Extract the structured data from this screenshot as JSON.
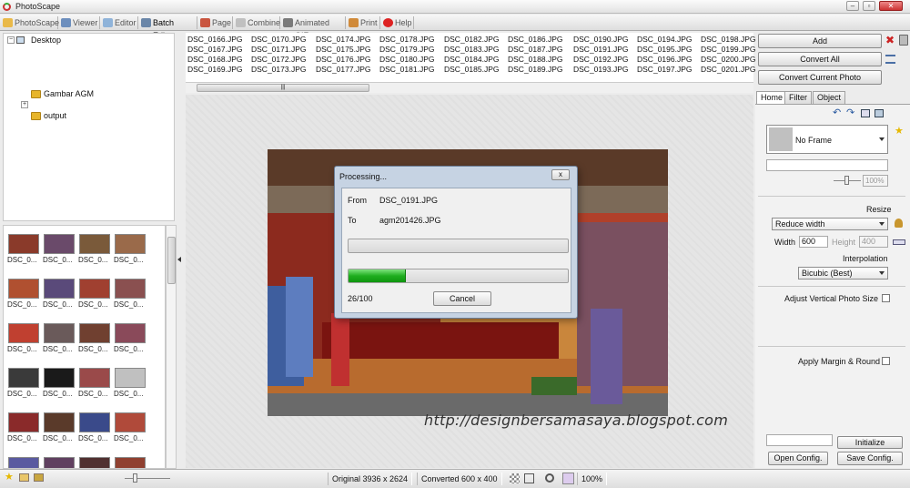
{
  "window": {
    "title": "PhotoScape"
  },
  "menu": {
    "tabs": [
      "PhotoScape",
      "Viewer",
      "Editor",
      "Batch Editor",
      "Page",
      "Combine",
      "Animated GIF",
      "Print",
      "Help"
    ],
    "active": "Batch Editor"
  },
  "tree": {
    "root": "Desktop",
    "folders": [
      "Gambar AGM",
      "output"
    ]
  },
  "thumbnails": {
    "caption": "DSC_0..."
  },
  "files": [
    [
      "DSC_0166.JPG",
      "DSC_0167.JPG",
      "DSC_0168.JPG",
      "DSC_0169.JPG"
    ],
    [
      "DSC_0170.JPG",
      "DSC_0171.JPG",
      "DSC_0172.JPG",
      "DSC_0173.JPG"
    ],
    [
      "DSC_0174.JPG",
      "DSC_0175.JPG",
      "DSC_0176.JPG",
      "DSC_0177.JPG"
    ],
    [
      "DSC_0178.JPG",
      "DSC_0179.JPG",
      "DSC_0180.JPG",
      "DSC_0181.JPG"
    ],
    [
      "DSC_0182.JPG",
      "DSC_0183.JPG",
      "DSC_0184.JPG",
      "DSC_0185.JPG"
    ],
    [
      "DSC_0186.JPG",
      "DSC_0187.JPG",
      "DSC_0188.JPG",
      "DSC_0189.JPG"
    ],
    [
      "DSC_0190.JPG",
      "DSC_0191.JPG",
      "DSC_0192.JPG",
      "DSC_0193.JPG"
    ],
    [
      "DSC_0194.JPG",
      "DSC_0195.JPG",
      "DSC_0196.JPG",
      "DSC_0197.JPG"
    ],
    [
      "DSC_0198.JPG",
      "DSC_0199.JPG",
      "DSC_0200.JPG",
      "DSC_0201.JPG"
    ]
  ],
  "dialog": {
    "title": "Processing...",
    "from_label": "From",
    "from_value": "DSC_0191.JPG",
    "to_label": "To",
    "to_value": "agm201426.JPG",
    "progress_text": "26/100",
    "progress_fraction": 0.26,
    "cancel_label": "Cancel",
    "close_label": "x"
  },
  "watermark": "http://designbersamasaya.blogspot.com",
  "right": {
    "add_label": "Add",
    "convert_all_label": "Convert All",
    "convert_current_label": "Convert Current Photo",
    "tabs": [
      "Home",
      "Filter",
      "Object"
    ],
    "frame_value": "No Frame",
    "frame_percent": "100%",
    "resize_label": "Resize",
    "resize_mode": "Reduce width",
    "width_label": "Width",
    "width_value": "600",
    "height_label": "Height",
    "height_value": "400",
    "interpolation_label": "Interpolation",
    "interpolation_value": "Bicubic (Best)",
    "adjust_label": "Adjust Vertical Photo Size",
    "margin_label": "Apply Margin & Round",
    "initialize_label": "Initialize",
    "open_config_label": "Open Config.",
    "save_config_label": "Save Config."
  },
  "status": {
    "original": "Original 3936 x 2624",
    "converted": "Converted 600 x 400",
    "zoom": "100%"
  },
  "colors": {
    "progress_green": "#1fae1f",
    "dialog_frame": "#c6d3e3",
    "folder": "#e7b52b"
  }
}
